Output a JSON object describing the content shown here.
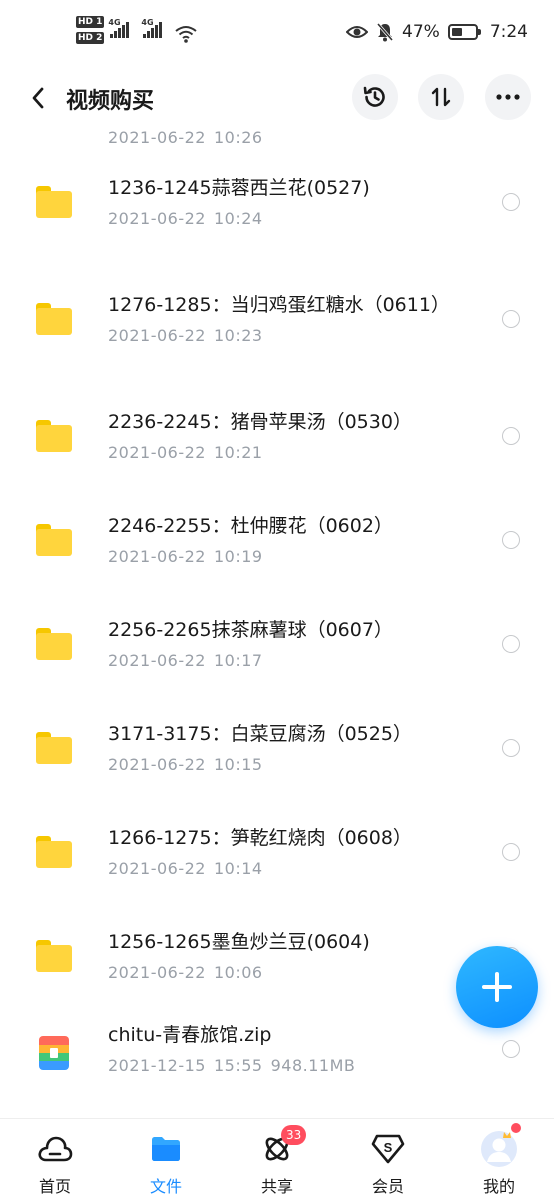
{
  "status_bar": {
    "hd1": "HD 1",
    "hd2": "HD 2",
    "signal1_label": "4G",
    "signal2_label": "4G",
    "battery_percent": "47%",
    "battery_level": 0.47,
    "time": "7:24"
  },
  "header": {
    "title": "视频购买"
  },
  "files": [
    {
      "name": "",
      "date": "2021-06-22",
      "time": "10:26",
      "size": "",
      "type": "folder"
    },
    {
      "name": "1236-1245蒜蓉西兰花(0527)",
      "date": "2021-06-22",
      "time": "10:24",
      "size": "",
      "type": "folder"
    },
    {
      "name": "1276-1285：当归鸡蛋红糖水（0611）",
      "date": "2021-06-22",
      "time": "10:23",
      "size": "",
      "type": "folder"
    },
    {
      "name": "2236-2245：猪骨苹果汤（0530）",
      "date": "2021-06-22",
      "time": "10:21",
      "size": "",
      "type": "folder"
    },
    {
      "name": "2246-2255：杜仲腰花（0602）",
      "date": "2021-06-22",
      "time": "10:19",
      "size": "",
      "type": "folder"
    },
    {
      "name": "2256-2265抹茶麻薯球（0607）",
      "date": "2021-06-22",
      "time": "10:17",
      "size": "",
      "type": "folder"
    },
    {
      "name": "3171-3175：白菜豆腐汤（0525）",
      "date": "2021-06-22",
      "time": "10:15",
      "size": "",
      "type": "folder"
    },
    {
      "name": "1266-1275：笋乾红烧肉（0608）",
      "date": "2021-06-22",
      "time": "10:14",
      "size": "",
      "type": "folder"
    },
    {
      "name": "1256-1265墨鱼炒兰豆(0604)",
      "date": "2021-06-22",
      "time": "10:06",
      "size": "",
      "type": "folder"
    },
    {
      "name": "chitu-青春旅馆.zip",
      "date": "2021-12-15",
      "time": "15:55",
      "size": "948.11MB",
      "type": "zip"
    }
  ],
  "bottom_nav": {
    "home_label": "首页",
    "files_label": "文件",
    "share_label": "共享",
    "share_badge": "33",
    "vip_label": "会员",
    "vip_icon_letter": "S",
    "me_label": "我的"
  },
  "colors": {
    "accent": "#1a8cff",
    "folder": "#ffd53d",
    "badge": "#ff4d5e",
    "meta_text": "#9aa0a8"
  }
}
